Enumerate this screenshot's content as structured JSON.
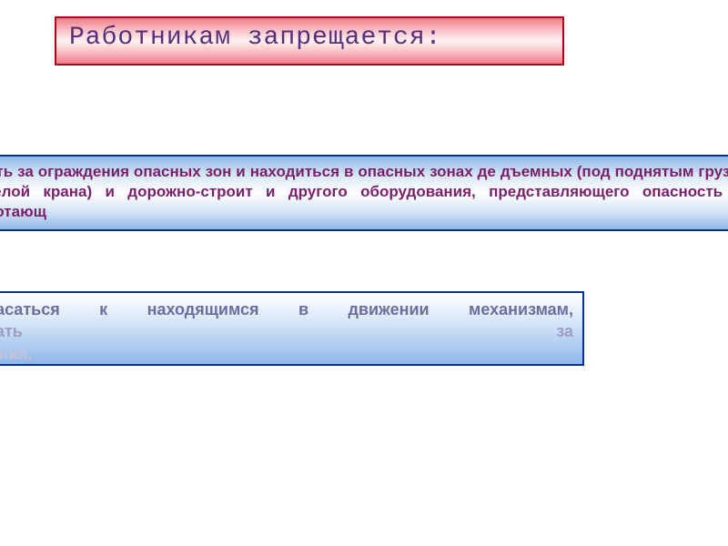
{
  "title": "Работникам запрещается:",
  "block_a": "одить за ограждения опасных зон и находиться в опасных зонах де дъемных (под поднятым грузом и стрелой крана) и дорожно-строит и другого оборудования, представляющего опасность для работающ",
  "block_b": {
    "line1_words": [
      "рикасаться",
      "к",
      "находящимся",
      "в",
      "движении",
      "механизмам,"
    ],
    "line2_words": [
      "никать",
      "за"
    ],
    "line3": "ждения."
  }
}
